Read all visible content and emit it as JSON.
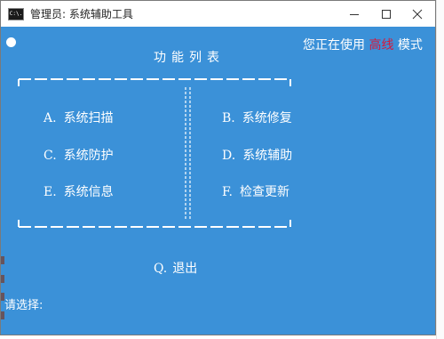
{
  "window": {
    "title": "管理员:  系统辅助工具",
    "icon_label": "C:\\.",
    "controls": {
      "minimize": "minimize-icon",
      "maximize": "maximize-icon",
      "close": "close-icon"
    }
  },
  "status": {
    "prefix": "您正在使用",
    "mode": "高线",
    "suffix": "模式"
  },
  "menu": {
    "title": "功能列表",
    "items": [
      {
        "key": "A.",
        "label": "系统扫描"
      },
      {
        "key": "B.",
        "label": "系统修复"
      },
      {
        "key": "C.",
        "label": "系统防护"
      },
      {
        "key": "D.",
        "label": "系统辅助"
      },
      {
        "key": "E.",
        "label": "系统信息"
      },
      {
        "key": "F.",
        "label": "检查更新"
      }
    ],
    "quit": {
      "key": "Q.",
      "label": "退出"
    }
  },
  "prompt": "请选择:",
  "colors": {
    "console_bg": "#3b91d8",
    "text": "#ffffff",
    "mode_highlight": "#d8173a"
  }
}
